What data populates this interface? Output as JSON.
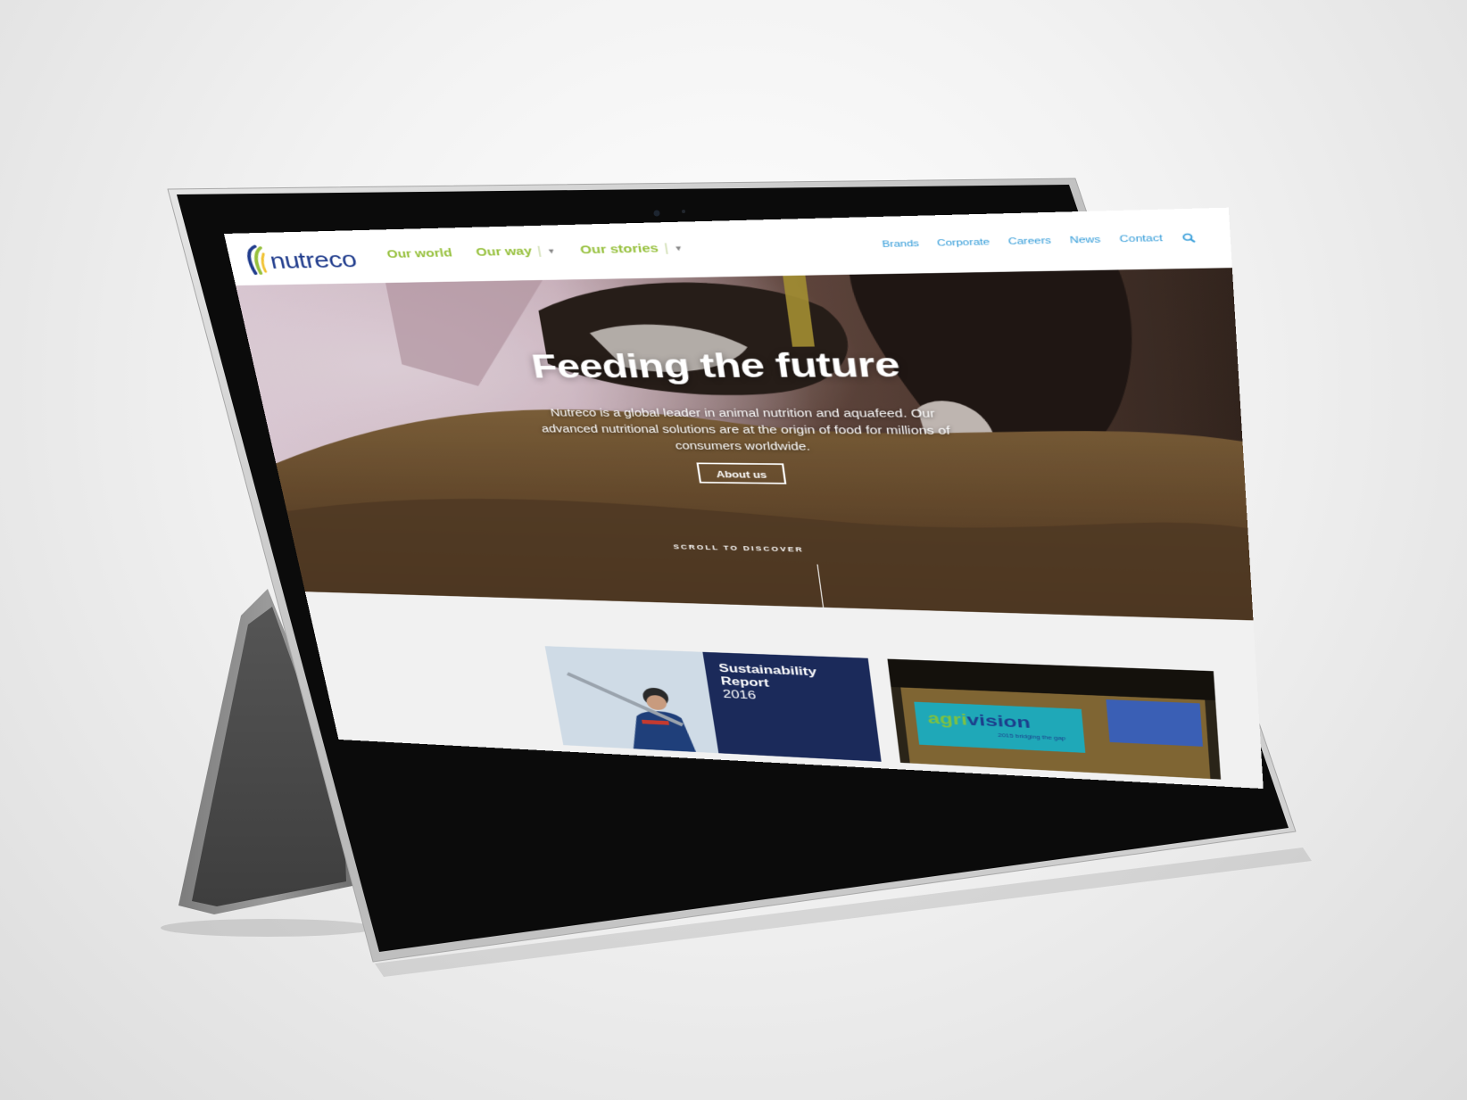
{
  "brand": {
    "name": "nutreco",
    "colors": {
      "primary_blue": "#1f3b8c",
      "accent_green": "#96c03c",
      "link_blue": "#2f9ad8",
      "report_navy": "#1b2a5a"
    }
  },
  "main_nav": {
    "items": [
      {
        "label": "Our world",
        "has_dropdown": false
      },
      {
        "label": "Our way",
        "has_dropdown": true
      },
      {
        "label": "Our stories",
        "has_dropdown": true
      }
    ]
  },
  "util_nav": {
    "items": [
      "Brands",
      "Corporate",
      "Careers",
      "News",
      "Contact"
    ],
    "search_icon": "search-icon"
  },
  "hero": {
    "title": "Feeding the future",
    "text": "Nutreco is a global leader in animal nutrition and aquafeed. Our advanced nutritional solutions are at the origin of food for millions of consumers worldwide.",
    "button": "About us",
    "scroll_cue": "SCROLL TO DISCOVER"
  },
  "cards": {
    "report": {
      "title_line1": "Sustainability",
      "title_line2": "Report",
      "year": "2016"
    },
    "agrivision": {
      "logo_part1": "agri",
      "logo_part2": "vision",
      "tagline": "2015 bridging the gap"
    }
  },
  "device": {
    "os_icon": "windows-logo-icon"
  }
}
